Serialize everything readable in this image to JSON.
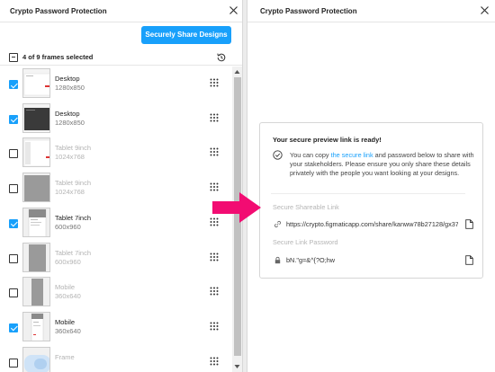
{
  "left_panel": {
    "title": "Crypto Password Protection",
    "share_button": "Securely Share Designs",
    "selection_summary": "4 of 9 frames selected",
    "frames": [
      {
        "name": "Desktop",
        "size": "1280x850",
        "checked": true,
        "dim": false
      },
      {
        "name": "Desktop",
        "size": "1280x850",
        "checked": true,
        "dim": false
      },
      {
        "name": "Tablet 9inch",
        "size": "1024x768",
        "checked": false,
        "dim": true
      },
      {
        "name": "Tablet 9inch",
        "size": "1024x768",
        "checked": false,
        "dim": true
      },
      {
        "name": "Tablet 7inch",
        "size": "600x960",
        "checked": true,
        "dim": false
      },
      {
        "name": "Tablet 7inch",
        "size": "600x960",
        "checked": false,
        "dim": true
      },
      {
        "name": "Mobile",
        "size": "360x640",
        "checked": false,
        "dim": true
      },
      {
        "name": "Mobile",
        "size": "360x640",
        "checked": true,
        "dim": false
      },
      {
        "name": "Frame",
        "size": "",
        "checked": false,
        "dim": true
      }
    ]
  },
  "right_panel": {
    "title": "Crypto Password Protection",
    "card_title": "Your secure preview link is ready!",
    "desc_before": "You can copy ",
    "desc_link": "the secure link",
    "desc_after": " and password below to share with your stakeholders. Please ensure you only share these details privately with the people you want looking at your designs.",
    "link_label": "Secure Shareable Link",
    "link_value": "https://crypto.figmaticapp.com/share/kanww78b27128/gx37",
    "password_label": "Secure Link Password",
    "password_value": "bN.\"g=&^{?O;hw"
  },
  "colors": {
    "accent": "#18a0fb",
    "arrow": "#f20c72"
  },
  "icons": [
    "close-icon",
    "history-icon",
    "drag-handle-icon",
    "check-circle-icon",
    "link-icon",
    "lock-icon",
    "copy-icon",
    "arrow-right-icon"
  ]
}
